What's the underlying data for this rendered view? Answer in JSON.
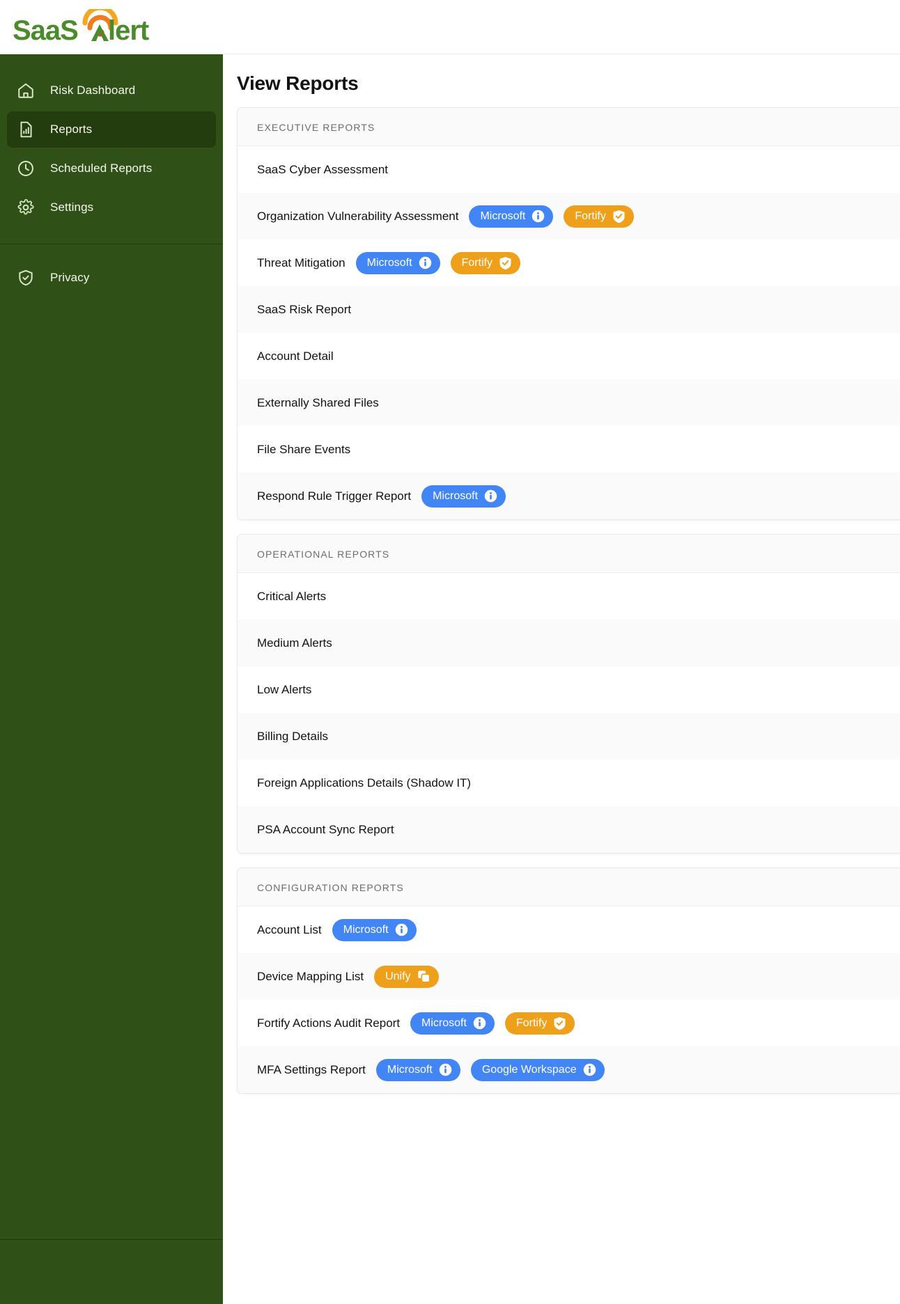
{
  "brand": {
    "logo_text_1": "SaaS",
    "logo_text_2": "lerts",
    "logo_name": "SaaS Alerts"
  },
  "colors": {
    "sidebar_bg": "#2f5016",
    "sidebar_active": "#233d0f",
    "badge_blue": "#4285f4",
    "badge_orange": "#efa01b",
    "logo_green": "#4a8b2c",
    "logo_orange": "#f5a623",
    "logo_red": "#e8412b"
  },
  "sidebar": {
    "items": [
      {
        "label": "Risk Dashboard",
        "icon": "home-icon",
        "active": false
      },
      {
        "label": "Reports",
        "icon": "report-chart-icon",
        "active": true
      },
      {
        "label": "Scheduled Reports",
        "icon": "clock-icon",
        "active": false
      },
      {
        "label": "Settings",
        "icon": "gear-icon",
        "active": false
      }
    ],
    "bottom_items": [
      {
        "label": "Privacy",
        "icon": "shield-check-icon",
        "active": false
      }
    ]
  },
  "main": {
    "title": "View Reports",
    "sections": [
      {
        "header": "EXECUTIVE REPORTS",
        "rows": [
          {
            "label": "SaaS Cyber Assessment",
            "badges": []
          },
          {
            "label": "Organization Vulnerability Assessment",
            "badges": [
              {
                "text": "Microsoft",
                "type": "microsoft",
                "icon": "info-icon"
              },
              {
                "text": "Fortify",
                "type": "fortify",
                "icon": "shield-check-icon"
              }
            ]
          },
          {
            "label": "Threat Mitigation",
            "badges": [
              {
                "text": "Microsoft",
                "type": "microsoft",
                "icon": "info-icon"
              },
              {
                "text": "Fortify",
                "type": "fortify",
                "icon": "shield-check-icon"
              }
            ]
          },
          {
            "label": "SaaS Risk Report",
            "badges": []
          },
          {
            "label": "Account Detail",
            "badges": []
          },
          {
            "label": "Externally Shared Files",
            "badges": []
          },
          {
            "label": "File Share Events",
            "badges": []
          },
          {
            "label": "Respond Rule Trigger Report",
            "badges": [
              {
                "text": "Microsoft",
                "type": "microsoft",
                "icon": "info-icon"
              }
            ]
          }
        ]
      },
      {
        "header": "OPERATIONAL REPORTS",
        "rows": [
          {
            "label": "Critical Alerts",
            "badges": []
          },
          {
            "label": "Medium Alerts",
            "badges": []
          },
          {
            "label": "Low Alerts",
            "badges": []
          },
          {
            "label": "Billing Details",
            "badges": []
          },
          {
            "label": "Foreign Applications Details (Shadow IT)",
            "badges": []
          },
          {
            "label": "PSA Account Sync Report",
            "badges": []
          }
        ]
      },
      {
        "header": "CONFIGURATION REPORTS",
        "rows": [
          {
            "label": "Account List",
            "badges": [
              {
                "text": "Microsoft",
                "type": "microsoft",
                "icon": "info-icon"
              }
            ]
          },
          {
            "label": "Device Mapping List",
            "badges": [
              {
                "text": "Unify",
                "type": "unify",
                "icon": "copy-layers-icon"
              }
            ]
          },
          {
            "label": "Fortify Actions Audit Report",
            "badges": [
              {
                "text": "Microsoft",
                "type": "microsoft",
                "icon": "info-icon"
              },
              {
                "text": "Fortify",
                "type": "fortify",
                "icon": "shield-check-icon"
              }
            ]
          },
          {
            "label": "MFA Settings Report",
            "badges": [
              {
                "text": "Microsoft",
                "type": "microsoft",
                "icon": "info-icon"
              },
              {
                "text": "Google Workspace",
                "type": "google",
                "icon": "info-icon"
              }
            ]
          }
        ]
      }
    ]
  }
}
